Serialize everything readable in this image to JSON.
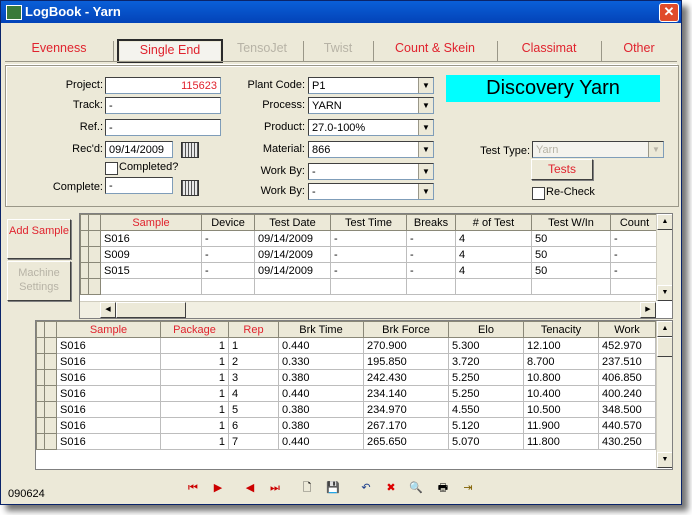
{
  "window": {
    "title": "LogBook - Yarn",
    "close_label": "✕"
  },
  "tabs": [
    {
      "label": "Evenness",
      "state": "normal"
    },
    {
      "label": "Single End",
      "state": "active"
    },
    {
      "label": "TensoJet",
      "state": "disabled"
    },
    {
      "label": "Twist",
      "state": "disabled"
    },
    {
      "label": "Count & Skein",
      "state": "normal"
    },
    {
      "label": "Classimat",
      "state": "normal"
    },
    {
      "label": "Other",
      "state": "normal"
    }
  ],
  "form": {
    "project_label": "Project:",
    "project_value": "115623",
    "track_label": "Track:",
    "track_value": "-",
    "ref_label": "Ref.:",
    "ref_value": "-",
    "recd_label": "Rec'd:",
    "recd_value": "09/14/2009",
    "completed_label": "Completed?",
    "complete_label": "Complete:",
    "complete_value": "-",
    "plant_label": "Plant Code:",
    "plant_value": "P1",
    "process_label": "Process:",
    "process_value": "YARN",
    "product_label": "Product:",
    "product_value": "27.0-100%",
    "material_label": "Material:",
    "material_value": "866",
    "workby1_label": "Work By:",
    "workby1_value": "-",
    "workby2_label": "Work By:",
    "workby2_value": "-",
    "banner": "Discovery Yarn",
    "testtype_label": "Test Type:",
    "testtype_value": "Yarn",
    "tests_button": "Tests",
    "recheck_label": "Re-Check"
  },
  "side_buttons": {
    "add_sample": "Add Sample",
    "machine_settings": "Machine Settings"
  },
  "samples_grid": {
    "columns": [
      "Sample",
      "Device",
      "Test Date",
      "Test Time",
      "Breaks",
      "# of Test",
      "Test W/In",
      "Count"
    ],
    "rows": [
      [
        "S016",
        "-",
        "09/14/2009",
        "-",
        "-",
        "4",
        "50",
        "-"
      ],
      [
        "S009",
        "-",
        "09/14/2009",
        "-",
        "-",
        "4",
        "50",
        "-"
      ],
      [
        "S015",
        "-",
        "09/14/2009",
        "-",
        "-",
        "4",
        "50",
        "-"
      ]
    ]
  },
  "results_grid": {
    "columns": [
      "Sample",
      "Package",
      "Rep",
      "Brk Time",
      "Brk Force",
      "Elo",
      "Tenacity",
      "Work"
    ],
    "rows": [
      [
        "S016",
        "1",
        "1",
        "0.440",
        "270.900",
        "5.300",
        "12.100",
        "452.970"
      ],
      [
        "S016",
        "1",
        "2",
        "0.330",
        "195.850",
        "3.720",
        "8.700",
        "237.510"
      ],
      [
        "S016",
        "1",
        "3",
        "0.380",
        "242.430",
        "5.250",
        "10.800",
        "406.850"
      ],
      [
        "S016",
        "1",
        "4",
        "0.440",
        "234.140",
        "5.250",
        "10.400",
        "400.240"
      ],
      [
        "S016",
        "1",
        "5",
        "0.380",
        "234.970",
        "4.550",
        "10.500",
        "348.500"
      ],
      [
        "S016",
        "1",
        "6",
        "0.380",
        "267.170",
        "5.120",
        "11.900",
        "440.570"
      ],
      [
        "S016",
        "1",
        "7",
        "0.440",
        "265.650",
        "5.070",
        "11.800",
        "430.250"
      ]
    ]
  },
  "toolbar": {
    "buttons": [
      {
        "name": "first-record",
        "glyph": "⏮"
      },
      {
        "name": "next-record",
        "glyph": "▶"
      },
      {
        "name": "previous-record",
        "glyph": "◀"
      },
      {
        "name": "last-record",
        "glyph": "⏭"
      },
      {
        "name": "new-record",
        "glyph": "🗋"
      },
      {
        "name": "save",
        "glyph": "💾"
      },
      {
        "name": "undo",
        "glyph": "↶"
      },
      {
        "name": "delete",
        "glyph": "✖"
      },
      {
        "name": "find",
        "glyph": "🔍"
      },
      {
        "name": "print",
        "glyph": "🖶"
      },
      {
        "name": "exit",
        "glyph": "⇥"
      }
    ]
  },
  "status": {
    "code": "090624"
  },
  "colors": {
    "accent_red": "#e0232e",
    "banner_cyan": "#00ffff",
    "title_blue": "#0a5fd8"
  }
}
